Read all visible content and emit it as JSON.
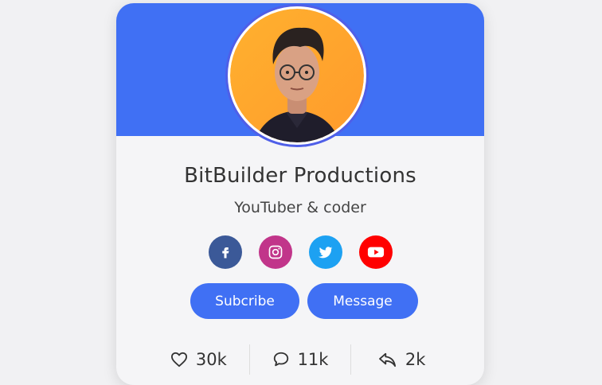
{
  "profile": {
    "name": "BitBuilder Productions",
    "role": "YouTuber & coder"
  },
  "socials": [
    {
      "network": "facebook",
      "icon": "facebook-icon",
      "color": "#3b5998"
    },
    {
      "network": "instagram",
      "icon": "instagram-icon",
      "color": "#c1358a"
    },
    {
      "network": "twitter",
      "icon": "twitter-icon",
      "color": "#1da1f2"
    },
    {
      "network": "youtube",
      "icon": "youtube-icon",
      "color": "#ff0000"
    }
  ],
  "buttons": {
    "subscribe_label": "Subcribe",
    "message_label": "Message"
  },
  "stats": {
    "likes": "30k",
    "comments": "11k",
    "shares": "2k"
  },
  "colors": {
    "accent": "#4070f4",
    "background": "#f1f1f3",
    "card": "#f5f5f7"
  }
}
